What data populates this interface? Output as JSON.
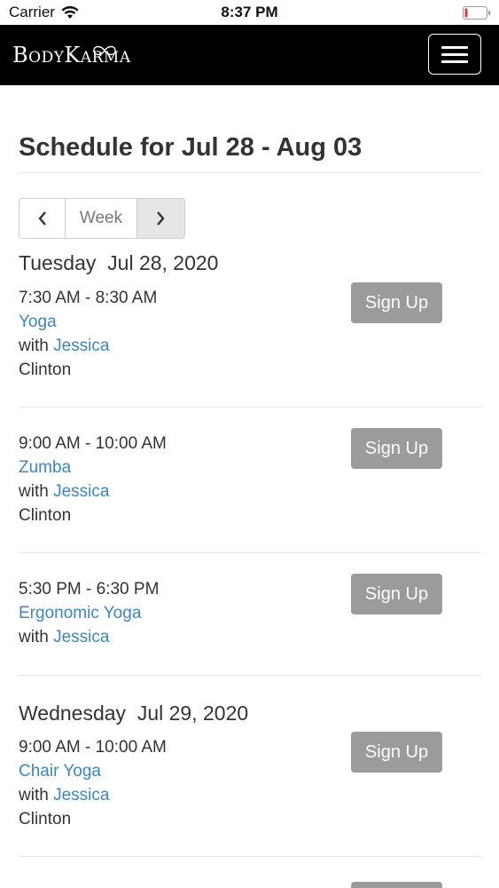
{
  "status_bar": {
    "carrier": "Carrier",
    "time": "8:37 PM"
  },
  "navbar": {
    "brand": "BodyKarma",
    "menu_icon": "hamburger-menu-icon"
  },
  "schedule": {
    "title": "Schedule for Jul 28 - Aug 03",
    "pager": {
      "prev_icon": "chevron-left-icon",
      "label": "Week",
      "next_icon": "chevron-right-icon"
    },
    "signup_label": "Sign Up",
    "with_label": "with",
    "days": [
      {
        "weekday": "Tuesday",
        "date": "Jul 28, 2020",
        "sessions": [
          {
            "time": "7:30 AM - 8:30 AM",
            "class": "Yoga",
            "instructor": "Jessica",
            "location": "Clinton"
          },
          {
            "time": "9:00 AM - 10:00 AM",
            "class": "Zumba",
            "instructor": "Jessica",
            "location": "Clinton"
          },
          {
            "time": "5:30 PM - 6:30 PM",
            "class": "Ergonomic Yoga",
            "instructor": "Jessica",
            "location": ""
          }
        ]
      },
      {
        "weekday": "Wednesday",
        "date": "Jul 29, 2020",
        "sessions": [
          {
            "time": "9:00 AM - 10:00 AM",
            "class": "Chair Yoga",
            "instructor": "Jessica",
            "location": "Clinton"
          }
        ]
      }
    ]
  },
  "colors": {
    "navbar_bg": "#000000",
    "link": "#3a87c2",
    "signup_bg": "#9b9b9b",
    "text": "#333333"
  }
}
